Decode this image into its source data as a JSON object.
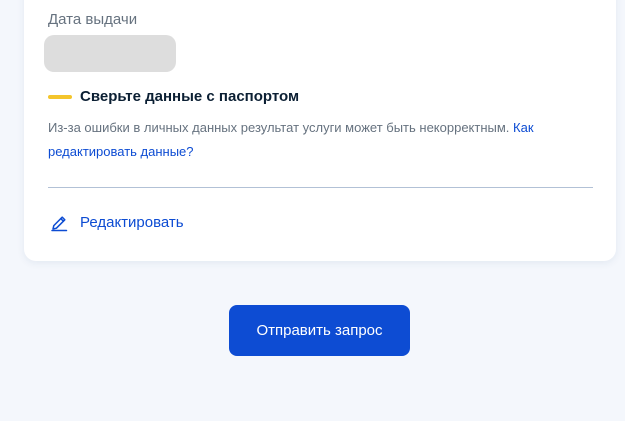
{
  "card": {
    "issue_date_label": "Дата выдачи",
    "warning": {
      "title": "Сверьте данные с паспортом",
      "color": "#f4c52c"
    },
    "description": {
      "text": "Из-за ошибки в личных данных результат услуги может быть некорректным. ",
      "link_text": "Как редактировать данные?"
    },
    "edit": {
      "icon": "pencil-icon",
      "label": "Редактировать"
    }
  },
  "submit_button": {
    "label": "Отправить запрос",
    "color": "#0d4cd3"
  }
}
